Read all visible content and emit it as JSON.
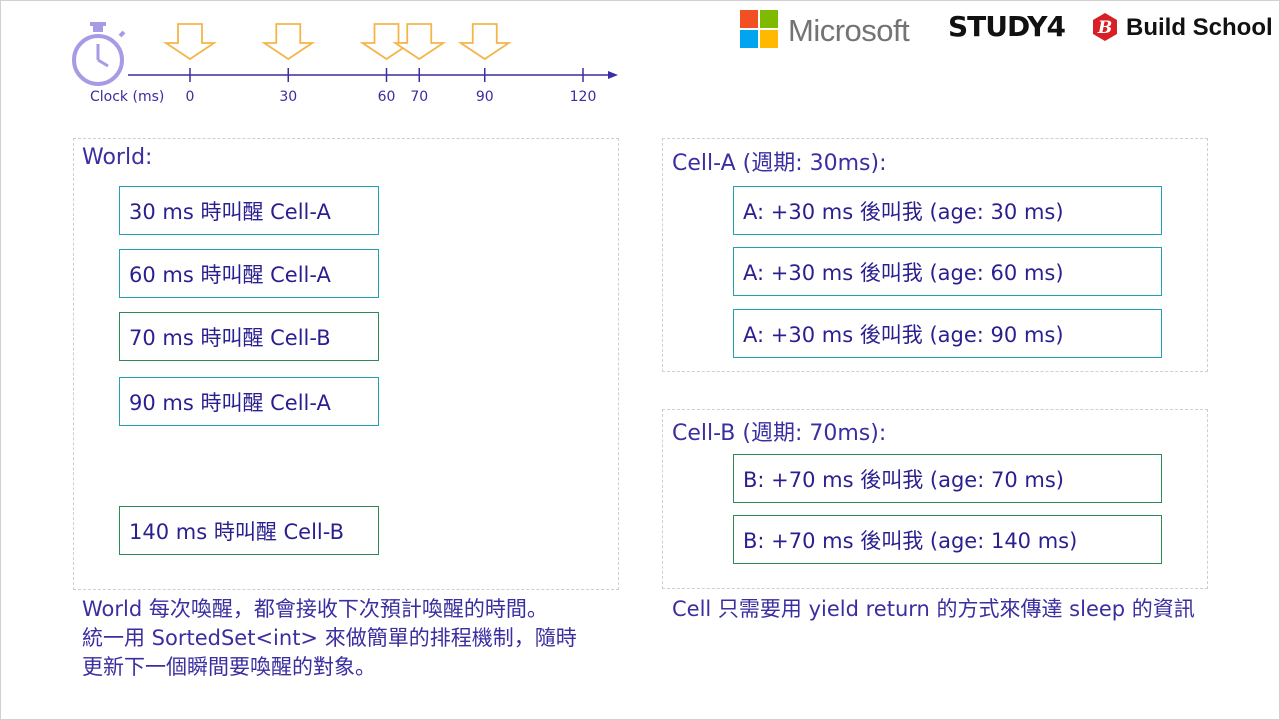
{
  "timeline": {
    "label": "Clock (ms)",
    "ticks": [
      "0",
      "30",
      "60",
      "70",
      "90",
      "120"
    ],
    "tick_values": [
      0,
      30,
      60,
      70,
      90,
      120
    ],
    "wake_markers": [
      0,
      30,
      60,
      70,
      90
    ],
    "axis_max": 135,
    "colors": {
      "axis": "#3a2ea0",
      "marker": "#f5b54a",
      "clock": "#a99ae6"
    }
  },
  "logos": {
    "microsoft": {
      "text": "Microsoft",
      "colors": [
        "#f25022",
        "#7fba00",
        "#00a4ef",
        "#ffb900"
      ]
    },
    "study4": {
      "text": "STUDY4"
    },
    "buildschool": {
      "text": "Build School",
      "mark": "B",
      "color": "#d81f26"
    }
  },
  "world": {
    "title": "World:",
    "items": [
      "30 ms 時叫醒 Cell-A",
      "60 ms 時叫醒 Cell-A",
      "70 ms 時叫醒 Cell-B",
      "90 ms 時叫醒 Cell-A",
      "140 ms 時叫醒 Cell-B"
    ],
    "caption": [
      "World 每次喚醒，都會接收下次預計喚醒的時間。",
      "統一用 SortedSet<int> 來做簡單的排程機制，隨時",
      "更新下一個瞬間要喚醒的對象。"
    ]
  },
  "cell_a": {
    "title": "Cell-A (週期: 30ms):",
    "items": [
      "A: +30 ms 後叫我 (age: 30 ms)",
      "A: +30 ms 後叫我 (age: 60 ms)",
      "A: +30 ms 後叫我 (age: 90 ms)"
    ]
  },
  "cell_b": {
    "title": "Cell-B (週期: 70ms):",
    "items": [
      "B: +70 ms 後叫我 (age: 70 ms)",
      "B: +70 ms 後叫我 (age: 140 ms)"
    ]
  },
  "cell_caption": "Cell 只需要用 yield return 的方式來傳達 sleep 的資訊"
}
